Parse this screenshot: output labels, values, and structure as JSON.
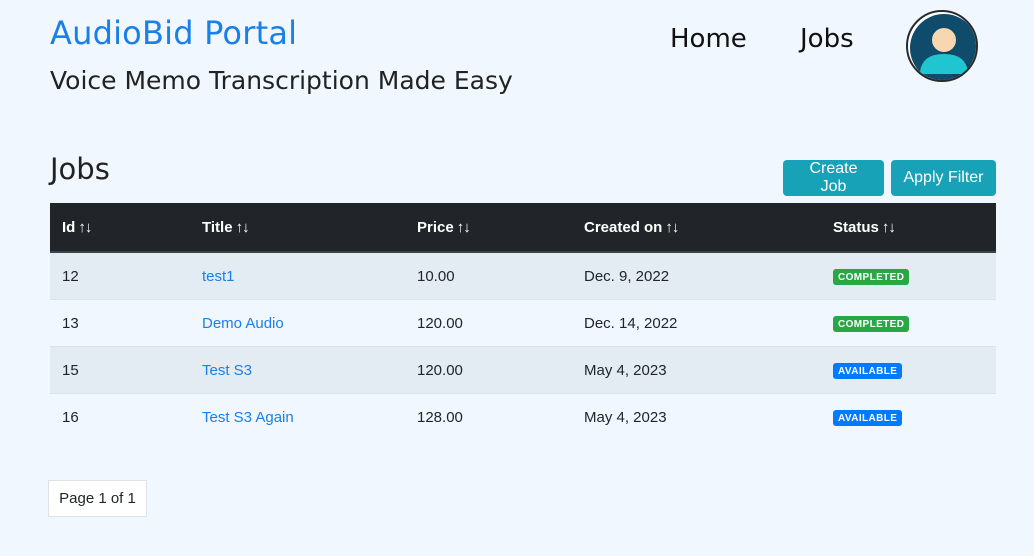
{
  "header": {
    "brand": "AudioBid Portal",
    "tagline": "Voice Memo Transcription Made Easy",
    "nav": {
      "home": "Home",
      "jobs": "Jobs"
    }
  },
  "main": {
    "title": "Jobs",
    "create_label": "Create Job",
    "filter_label": "Apply Filter",
    "columns": [
      "Id",
      "Title",
      "Price",
      "Created on",
      "Status"
    ],
    "sort_glyph": "↑↓",
    "rows": [
      {
        "id": "12",
        "title": "test1",
        "price": "10.00",
        "created": "Dec. 9, 2022",
        "status": "COMPLETED"
      },
      {
        "id": "13",
        "title": "Demo Audio",
        "price": "120.00",
        "created": "Dec. 14, 2022",
        "status": "COMPLETED"
      },
      {
        "id": "15",
        "title": "Test S3",
        "price": "120.00",
        "created": "May 4, 2023",
        "status": "AVAILABLE"
      },
      {
        "id": "16",
        "title": "Test S3 Again",
        "price": "128.00",
        "created": "May 4, 2023",
        "status": "AVAILABLE"
      }
    ],
    "pagination": "Page 1 of 1"
  },
  "colors": {
    "brand": "#1a7fe8",
    "accent_button": "#17a2b8",
    "header_row": "#212529",
    "completed": "#28a745",
    "available": "#007bff"
  },
  "icons": {
    "avatar": "user-avatar-icon",
    "sort": "sort-arrows-icon"
  }
}
